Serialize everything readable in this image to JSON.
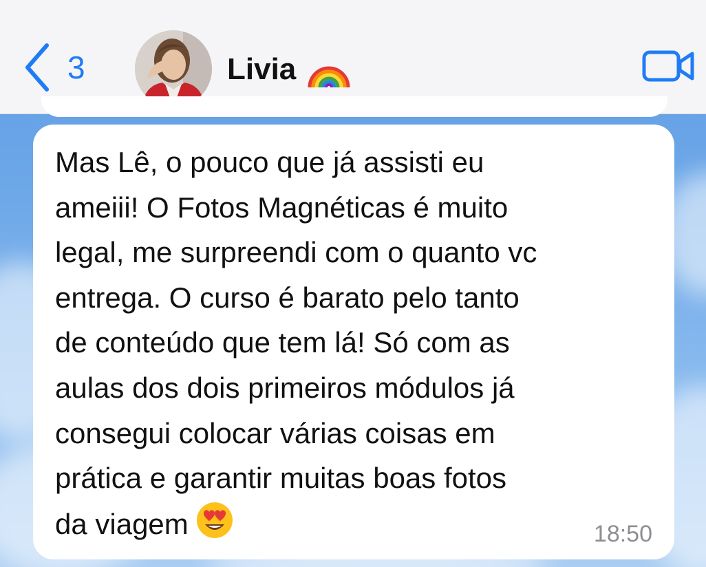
{
  "header": {
    "back_count": "3",
    "contact_name": "Livia",
    "contact_emoji": "rainbow-emoji",
    "video_icon": "video-camera-icon",
    "accent_color": "#1f7cf5"
  },
  "message": {
    "text": "Mas Lê, o pouco que já assisti eu\nameiii! O Fotos Magnéticas é muito\nlegal, me surpreendi com o quanto vc\nentrega. O curso é barato pelo tanto\nde conteúdo que tem lá! Só com as\naulas dos dois primeiros módulos já\nconsegui colocar várias coisas em\nprática e garantir muitas boas fotos\nda viagem",
    "emoji": "heart-eyes-emoji",
    "time": "18:50"
  }
}
